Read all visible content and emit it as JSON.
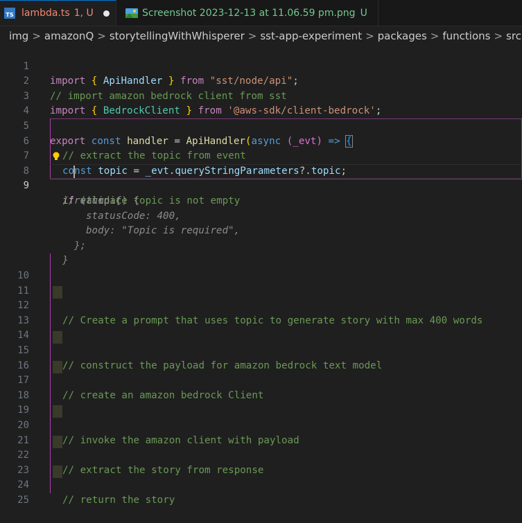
{
  "tabs": [
    {
      "filename": "lambda.ts",
      "status": "1, U",
      "icon": "typescript-icon",
      "active": true,
      "dirty": true
    },
    {
      "filename": "Screenshot 2023-12-13 at 11.06.59 pm.png",
      "status": "U",
      "icon": "image-icon",
      "active": false
    }
  ],
  "breadcrumb": [
    "img",
    "amazonQ",
    "storytellingWithWhisperer",
    "sst-app-experiment",
    "packages",
    "functions",
    "src"
  ],
  "breadcrumb_sep": ">",
  "editor": {
    "line_numbers": [
      "1",
      "2",
      "3",
      "4",
      "5",
      "6",
      "7",
      "8",
      "9",
      "10",
      "11",
      "12",
      "13",
      "14",
      "15",
      "16",
      "17",
      "18",
      "19",
      "20",
      "21",
      "22",
      "23",
      "24",
      "25"
    ],
    "current_line": "9",
    "lines": {
      "l1": {
        "import": "import",
        "open": "{",
        "name": "ApiHandler",
        "close": "}",
        "from": "from",
        "path": "\"sst/node/api\"",
        "semi": ";"
      },
      "l2": {
        "comment": "// import amazon bedrock client from sst"
      },
      "l3": {
        "import": "import",
        "open": "{",
        "name": "BedrockClient",
        "close": "}",
        "from": "from",
        "path": "'@aws-sdk/client-bedrock'",
        "semi": ";"
      },
      "l5": {
        "export": "export",
        "const": "const",
        "name": "handler",
        "eq": "=",
        "fn": "ApiHandler",
        "paren": "(",
        "async": "async",
        "params": "(_evt)",
        "arrow": "=>",
        "brace": "{"
      },
      "l6": {
        "comment": "// extract the topic from event"
      },
      "l7": {
        "const": "const",
        "var": "topic",
        "eq": "=",
        "expr_obj": "_evt",
        "dot": ".",
        "prop": "queryStringParameters",
        "opt": "?.",
        "prop2": "topic",
        "semi": ";"
      },
      "l8": {
        "comment": "// validate topic is not empty"
      },
      "l9": {
        "kw": "if",
        "rest": " (!topic) {"
      },
      "ghost": {
        "g1": "return {",
        "g2_key": "statusCode:",
        "g2_val": "400,",
        "g3_key": "body:",
        "g3_val": "\"Topic is required\",",
        "g4": "};",
        "g5": "}"
      },
      "l12": {
        "comment": "// Create a prompt that uses topic to generate story with max 400 words"
      },
      "l15": {
        "comment": "// construct the payload for amazon bedrock text model"
      },
      "l17": {
        "comment": "// create an amazon bedrock Client"
      },
      "l20": {
        "comment": "// invoke the amazon client with payload"
      },
      "l22": {
        "comment": "// extract the story from response"
      },
      "l24": {
        "comment": "// return the story"
      }
    }
  },
  "colors": {
    "background": "#1f1f1f",
    "keyword": "#569cd6",
    "control_keyword": "#c586c0",
    "function": "#dcdcaa",
    "string": "#ce9178",
    "comment": "#6a9955",
    "variable": "#9cdcfe",
    "class": "#4ec9b0",
    "bracket_gold": "#ffd700",
    "bracket_purple": "#da70d6",
    "bracket_blue": "#179fff",
    "tab_error": "#f48771",
    "tab_untracked": "#73c991"
  }
}
